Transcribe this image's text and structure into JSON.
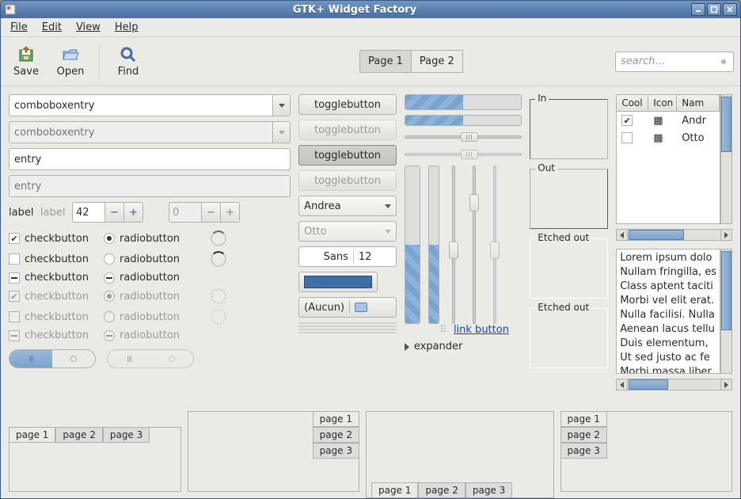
{
  "window": {
    "title": "GTK+ Widget Factory"
  },
  "menubar": {
    "file": "File",
    "edit": "Edit",
    "view": "View",
    "help": "Help"
  },
  "toolbar": {
    "save": "Save",
    "open": "Open",
    "find": "Find",
    "page1": "Page 1",
    "page2": "Page 2",
    "search_placeholder": "search..."
  },
  "col1": {
    "combo1": "comboboxentry",
    "combo2_placeholder": "comboboxentry",
    "entry1": "entry",
    "entry2_placeholder": "entry",
    "label": "label",
    "label_disabled": "label",
    "spin1": "42",
    "spin2": "0",
    "checkbutton": "checkbutton",
    "radiobutton": "radiobutton"
  },
  "col2": {
    "toggle": "togglebutton",
    "andrea": "Andrea",
    "otto": "Otto",
    "font_name": "Sans",
    "font_size": "12",
    "file_none": "(Aucun)"
  },
  "col3": {
    "progress1": 50,
    "progress2": 50,
    "scale1": 50,
    "scale2": 50,
    "vprog1": 50,
    "vprog2": 50,
    "vscale1": 50,
    "vscale2": 20,
    "vscale3": 50,
    "link": "link button",
    "expander": "expander"
  },
  "frames": {
    "in": "In",
    "out": "Out",
    "etched_out1": "Etched out",
    "etched_out2": "Etched out"
  },
  "treeview": {
    "cols": {
      "cool": "Cool",
      "icon": "Icon",
      "name": "Nam"
    },
    "rows": [
      {
        "cool": true,
        "name": "Andr"
      },
      {
        "cool": false,
        "name": "Otto"
      }
    ]
  },
  "textview": "Lorem ipsum dolo\nNullam fringilla, es\nClass aptent taciti\nMorbi vel elit erat.\nNulla facilisi. Nulla\nAenean lacus tellu\nDuis elementum,\nUt sed justo ac fe\nMorbi massa liber",
  "notebooks": {
    "p1": "page 1",
    "p2": "page 2",
    "p3": "page 3"
  }
}
